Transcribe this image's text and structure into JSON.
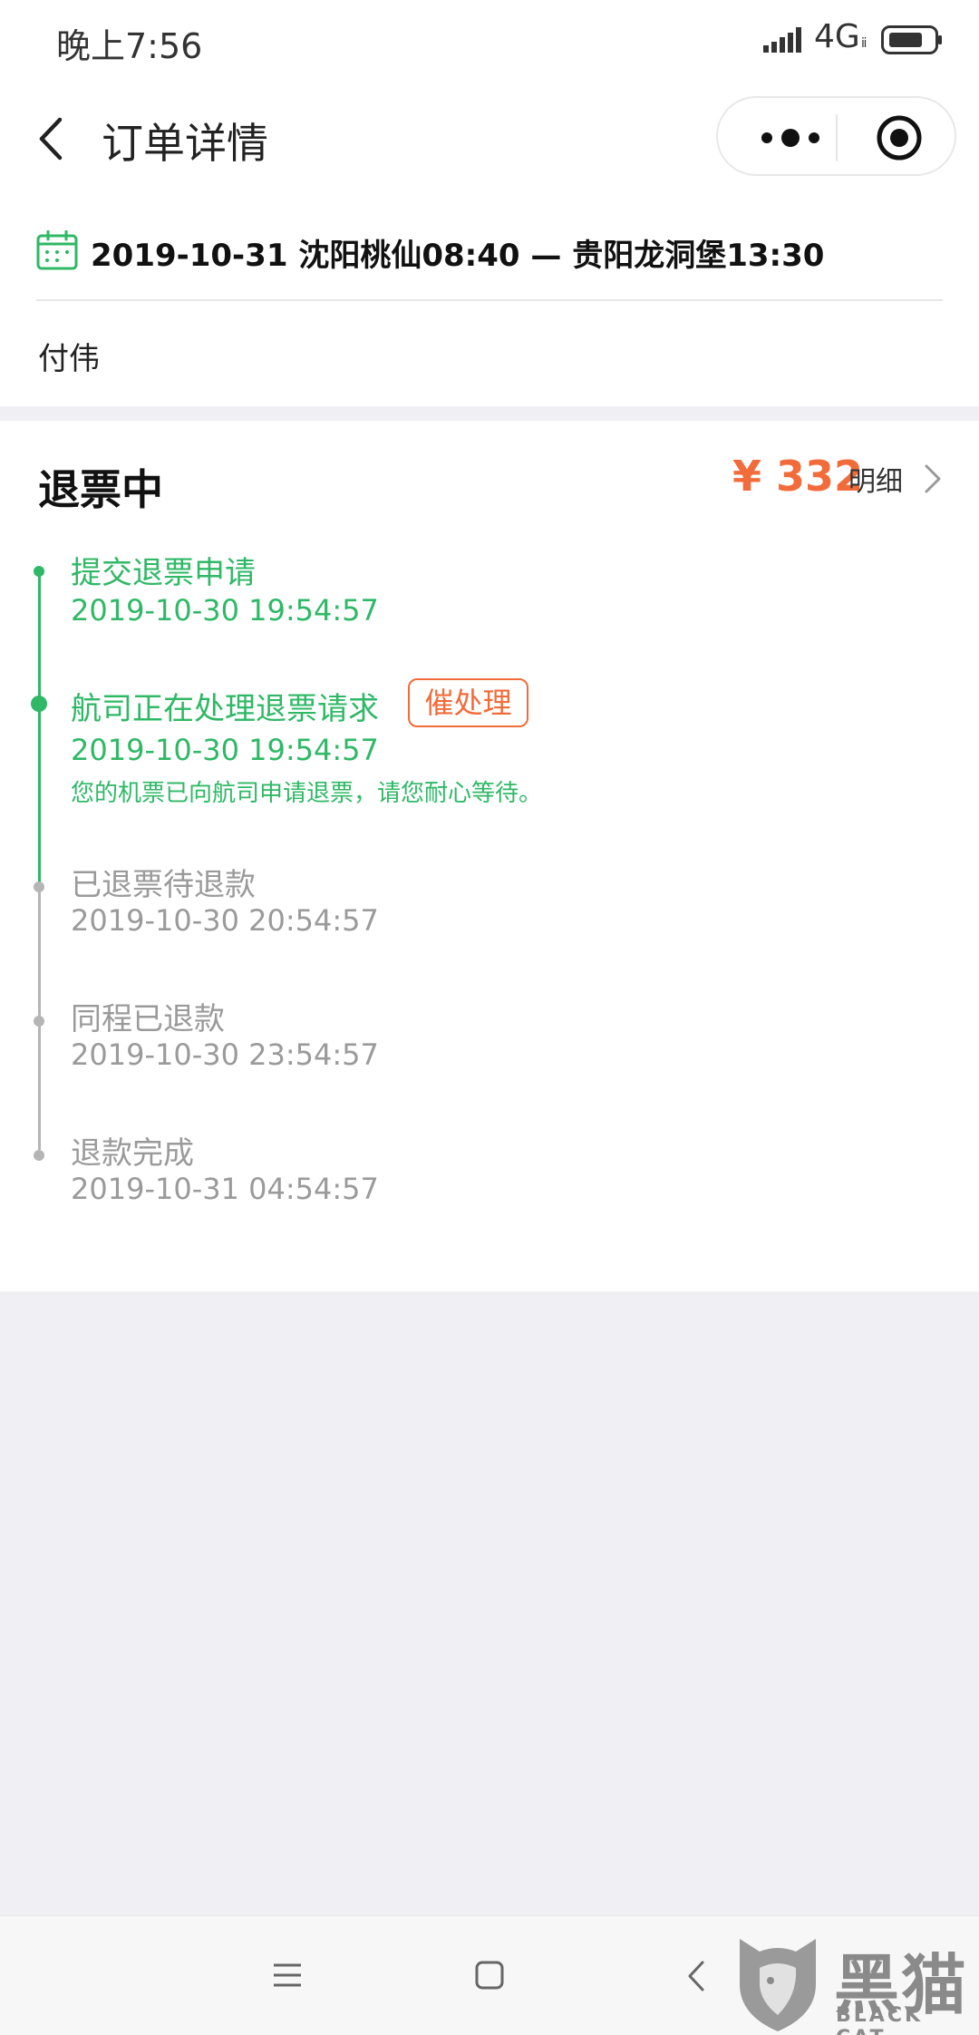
{
  "status_bar": {
    "time": "晚上7:56",
    "network": "4G",
    "network_sub": "ⅱ"
  },
  "nav": {
    "title": "订单详情"
  },
  "flight": {
    "summary": "2019-10-31 沈阳桃仙08:40 — 贵阳龙洞堡13:30",
    "passenger": "付伟"
  },
  "status": {
    "title": "退票中",
    "price": "¥ 332",
    "detail_label": "明细",
    "steps": [
      {
        "title": "提交退票申请",
        "time": "2019-10-30 19:54:57"
      },
      {
        "title": "航司正在处理退票请求",
        "time": "2019-10-30 19:54:57",
        "note": "您的机票已向航司申请退票，请您耐心等待。",
        "action": "催处理"
      },
      {
        "title": "已退票待退款",
        "time": "2019-10-30 20:54:57"
      },
      {
        "title": "同程已退款",
        "time": "2019-10-30 23:54:57"
      },
      {
        "title": "退款完成",
        "time": "2019-10-31 04:54:57"
      }
    ]
  },
  "watermark": {
    "cn": "黑猫",
    "en": "BLACK CAT"
  },
  "colors": {
    "accent_green": "#2fb866",
    "accent_orange": "#f26b3a",
    "inactive_gray": "#9a9a9a"
  }
}
